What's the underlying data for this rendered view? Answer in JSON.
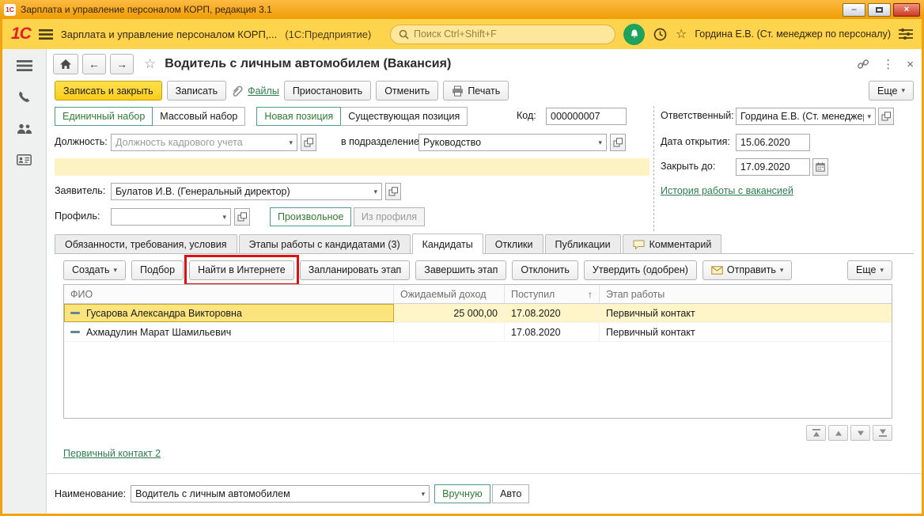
{
  "colors": {
    "titlebar_orange": "#f3a30f",
    "appbar_yellow": "#fdd44b",
    "primary_button_yellow": "#ffdb3d",
    "link_green": "#2e7d4f",
    "active_toggle_green": "#2f7d33",
    "annotation_red": "#e01010",
    "selected_row_yellow": "#fff5c8",
    "notification_green": "#1fa25c"
  },
  "icons": {
    "dropdown": "▾",
    "sort_asc": "↑",
    "star_empty": "☆",
    "back_arrow": "←",
    "forward_arrow": "→",
    "minimize": "–",
    "close": "×",
    "more_vertical": "⋮"
  },
  "titlebar": {
    "logo": "1С",
    "title": "Зарплата и управление персоналом КОРП, редакция 3.1"
  },
  "appbar": {
    "logo": "1С",
    "title": "Зарплата и управление персоналом КОРП,...",
    "mode": "(1С:Предприятие)",
    "search_placeholder": "Поиск Ctrl+Shift+F",
    "user": "Гордина Е.В. (Ст. менеджер по персоналу)"
  },
  "form": {
    "title": "Водитель с личным автомобилем (Вакансия)",
    "toolbar": {
      "save_close": "Записать и закрыть",
      "save": "Записать",
      "files": "Файлы",
      "suspend": "Приостановить",
      "cancel": "Отменить",
      "print": "Печать",
      "more": "Еще"
    },
    "fields": {
      "single_set": "Единичный набор",
      "mass_set": "Массовый набор",
      "new_position": "Новая позиция",
      "existing_position": "Существующая позиция",
      "code_label": "Код:",
      "code_value": "000000007",
      "responsible_label": "Ответственный:",
      "responsible_value": "Гордина Е.В. (Ст. менеджер п",
      "position_label": "Должность:",
      "position_placeholder": "Должность кадрового учета",
      "department_label": "в подразделение:",
      "department_value": "Руководство",
      "open_date_label": "Дата открытия:",
      "open_date_value": "15.06.2020",
      "close_date_label": "Закрыть до:",
      "close_date_value": "17.09.2020",
      "applicant_label": "Заявитель:",
      "applicant_value": "Булатов И.В. (Генеральный директор)",
      "history_link": "История работы с вакансией",
      "profile_label": "Профиль:",
      "profile_value": "",
      "arbitrary_btn": "Произвольное",
      "from_profile_btn": "Из профиля"
    },
    "tabs": [
      "Обязанности, требования, условия",
      "Этапы работы с кандидатами (3)",
      "Кандидаты",
      "Отклики",
      "Публикации",
      "Комментарий"
    ],
    "candidates": {
      "toolbar": {
        "create": "Создать",
        "selection": "Подбор",
        "find_internet": "Найти в Интернете",
        "plan_stage": "Запланировать этап",
        "finish_stage": "Завершить этап",
        "reject": "Отклонить",
        "approve": "Утвердить (одобрен)",
        "send": "Отправить",
        "more": "Еще"
      },
      "table": {
        "columns": [
          "ФИО",
          "Ожидаемый доход",
          "Поступил",
          "Этап работы"
        ],
        "rows": [
          {
            "fio": "Гусарова Александра Викторовна",
            "income": "25 000,00",
            "received": "17.08.2020",
            "stage": "Первичный контакт"
          },
          {
            "fio": "Ахмадулин Марат Шамильевич",
            "income": "",
            "received": "17.08.2020",
            "stage": "Первичный контакт"
          }
        ]
      },
      "stage_link": "Первичный контакт 2"
    },
    "footer": {
      "name_label": "Наименование:",
      "name_value": "Водитель с личным автомобилем",
      "manual_btn": "Вручную",
      "auto_btn": "Авто"
    }
  }
}
